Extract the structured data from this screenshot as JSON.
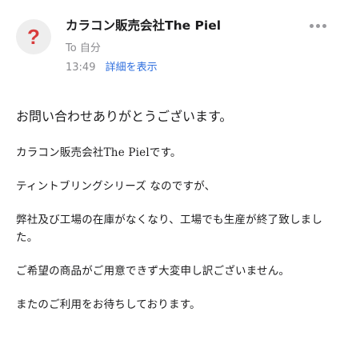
{
  "header": {
    "sender": "カラコン販売会社The Piel",
    "to_line": "To 自分",
    "time": "13:49",
    "details_link": "詳細を表示",
    "avatar_glyph": "?",
    "avatar_icon": "unknown-sender-icon",
    "more_icon": "more-horizontal-icon"
  },
  "body": {
    "greeting": "お問い合わせありがとうございます。",
    "paragraphs": [
      "カラコン販売会社The Pielです。",
      "ティントブリングシリーズ なのですが、",
      "弊社及び工場の在庫がなくなり、工場でも生産が終了致しました。",
      "ご希望の商品がご用意できず大変申し訳ございません。",
      "またのご利用をお待ちしております。"
    ]
  },
  "colors": {
    "accent": "#2f6fde",
    "avatar_glyph": "#d83b3b",
    "secondary_text": "#8a8a8e"
  }
}
